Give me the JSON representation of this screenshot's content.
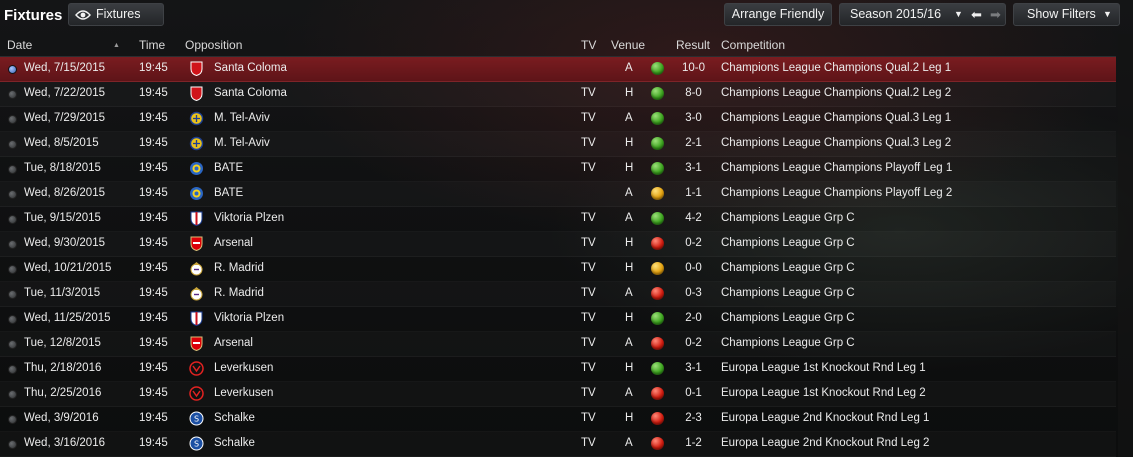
{
  "header": {
    "title": "Fixtures",
    "view_button": "Fixtures",
    "view_icon": "eye-icon",
    "arrange_button": "Arrange Friendly",
    "season_select": "Season 2015/16",
    "filters_button": "Show Filters"
  },
  "columns": {
    "date": "Date",
    "time": "Time",
    "opposition": "Opposition",
    "tv": "TV",
    "venue": "Venue",
    "result": "Result",
    "competition": "Competition"
  },
  "colors": {
    "win": "#3ea520",
    "draw": "#e3a210",
    "loss": "#d31d10",
    "selected_row": "#7a1c20"
  },
  "fixtures": [
    {
      "date": "Wed, 7/15/2015",
      "time": "19:45",
      "opponent": "Santa Coloma",
      "crest": "santa-coloma",
      "tv": "",
      "venue": "A",
      "outcome": "win",
      "result": "10-0",
      "competition": "Champions League Champions Qual.2 Leg 1",
      "selected": true
    },
    {
      "date": "Wed, 7/22/2015",
      "time": "19:45",
      "opponent": "Santa Coloma",
      "crest": "santa-coloma",
      "tv": "TV",
      "venue": "H",
      "outcome": "win",
      "result": "8-0",
      "competition": "Champions League Champions Qual.2 Leg 2"
    },
    {
      "date": "Wed, 7/29/2015",
      "time": "19:45",
      "opponent": "M. Tel-Aviv",
      "crest": "maccabi",
      "tv": "TV",
      "venue": "A",
      "outcome": "win",
      "result": "3-0",
      "competition": "Champions League Champions Qual.3 Leg 1"
    },
    {
      "date": "Wed, 8/5/2015",
      "time": "19:45",
      "opponent": "M. Tel-Aviv",
      "crest": "maccabi",
      "tv": "TV",
      "venue": "H",
      "outcome": "win",
      "result": "2-1",
      "competition": "Champions League Champions Qual.3 Leg 2"
    },
    {
      "date": "Tue, 8/18/2015",
      "time": "19:45",
      "opponent": "BATE",
      "crest": "bate",
      "tv": "TV",
      "venue": "H",
      "outcome": "win",
      "result": "3-1",
      "competition": "Champions League Champions Playoff Leg 1"
    },
    {
      "date": "Wed, 8/26/2015",
      "time": "19:45",
      "opponent": "BATE",
      "crest": "bate",
      "tv": "",
      "venue": "A",
      "outcome": "draw",
      "result": "1-1",
      "competition": "Champions League Champions Playoff Leg 2"
    },
    {
      "date": "Tue, 9/15/2015",
      "time": "19:45",
      "opponent": "Viktoria Plzen",
      "crest": "plzen",
      "tv": "TV",
      "venue": "A",
      "outcome": "win",
      "result": "4-2",
      "competition": "Champions League Grp C"
    },
    {
      "date": "Wed, 9/30/2015",
      "time": "19:45",
      "opponent": "Arsenal",
      "crest": "arsenal",
      "tv": "TV",
      "venue": "H",
      "outcome": "loss",
      "result": "0-2",
      "competition": "Champions League Grp C"
    },
    {
      "date": "Wed, 10/21/2015",
      "time": "19:45",
      "opponent": "R. Madrid",
      "crest": "real-madrid",
      "tv": "TV",
      "venue": "H",
      "outcome": "draw",
      "result": "0-0",
      "competition": "Champions League Grp C"
    },
    {
      "date": "Tue, 11/3/2015",
      "time": "19:45",
      "opponent": "R. Madrid",
      "crest": "real-madrid",
      "tv": "TV",
      "venue": "A",
      "outcome": "loss",
      "result": "0-3",
      "competition": "Champions League Grp C"
    },
    {
      "date": "Wed, 11/25/2015",
      "time": "19:45",
      "opponent": "Viktoria Plzen",
      "crest": "plzen",
      "tv": "TV",
      "venue": "H",
      "outcome": "win",
      "result": "2-0",
      "competition": "Champions League Grp C"
    },
    {
      "date": "Tue, 12/8/2015",
      "time": "19:45",
      "opponent": "Arsenal",
      "crest": "arsenal",
      "tv": "TV",
      "venue": "A",
      "outcome": "loss",
      "result": "0-2",
      "competition": "Champions League Grp C"
    },
    {
      "date": "Thu, 2/18/2016",
      "time": "19:45",
      "opponent": "Leverkusen",
      "crest": "leverkusen",
      "tv": "TV",
      "venue": "H",
      "outcome": "win",
      "result": "3-1",
      "competition": "Europa League 1st Knockout Rnd Leg 1"
    },
    {
      "date": "Thu, 2/25/2016",
      "time": "19:45",
      "opponent": "Leverkusen",
      "crest": "leverkusen",
      "tv": "TV",
      "venue": "A",
      "outcome": "loss",
      "result": "0-1",
      "competition": "Europa League 1st Knockout Rnd Leg 2"
    },
    {
      "date": "Wed, 3/9/2016",
      "time": "19:45",
      "opponent": "Schalke",
      "crest": "schalke",
      "tv": "TV",
      "venue": "H",
      "outcome": "loss",
      "result": "2-3",
      "competition": "Europa League 2nd Knockout Rnd Leg 1"
    },
    {
      "date": "Wed, 3/16/2016",
      "time": "19:45",
      "opponent": "Schalke",
      "crest": "schalke",
      "tv": "TV",
      "venue": "A",
      "outcome": "loss",
      "result": "1-2",
      "competition": "Europa League 2nd Knockout Rnd Leg 2"
    }
  ]
}
